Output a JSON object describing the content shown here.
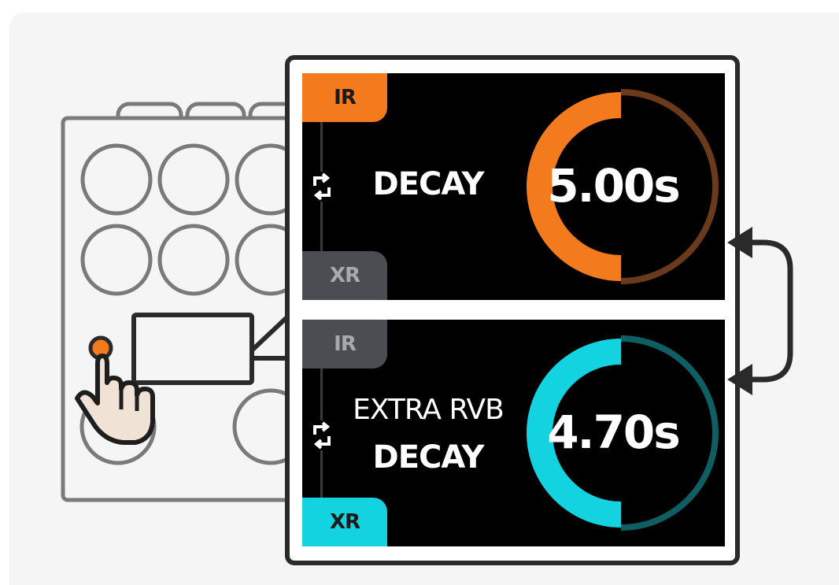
{
  "colors": {
    "orange": "#f47a1e",
    "orange_dim": "#6b3a1a",
    "cyan": "#12d3df",
    "cyan_dim": "#0f5e63",
    "inactive_tab": "#4a4d52",
    "frame": "#2a2a2a",
    "device_outline": "#7a7a7a"
  },
  "screens": [
    {
      "top_tab": "IR",
      "bottom_tab": "XR",
      "active_tab": "IR",
      "label_lines": [
        "DECAY"
      ],
      "value": "5.00s",
      "ring_fill_fraction": 0.5
    },
    {
      "top_tab": "IR",
      "bottom_tab": "XR",
      "active_tab": "XR",
      "label_lines": [
        "EXTRA RVB",
        "DECAY"
      ],
      "value": "4.70s",
      "ring_fill_fraction": 0.5
    }
  ],
  "icons": {
    "swap": "swap-arrows-icon",
    "hand": "pointing-hand-icon",
    "toggle_arrow": "double-arrow-icon"
  }
}
